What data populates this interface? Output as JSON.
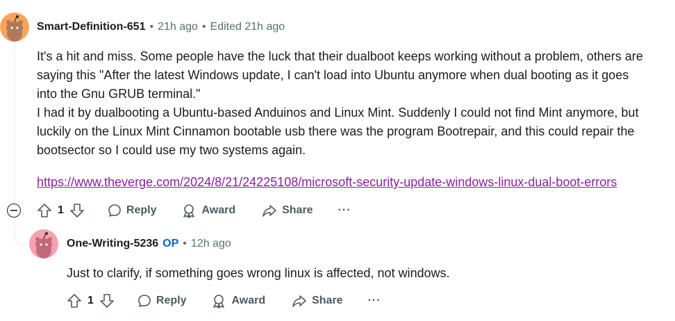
{
  "comment1": {
    "username": "Smart-Definition-651",
    "time": "21h ago",
    "edited": "Edited 21h ago",
    "lines": [
      "It's a hit and miss. Some people have the luck that their dualboot keeps working without a problem, others are",
      "saying this \"After the latest Windows update, I can't load into Ubuntu anymore when dual booting as it goes",
      "into the Gnu GRUB terminal.\"",
      "I had it by dualbooting a Ubuntu-based Anduinos and Linux Mint. Suddenly I could not find Mint anymore, but",
      "luckily on the Linux Mint Cinnamon bootable usb there was the program Bootrepair, and this could repair the",
      "bootsector so I could use my two systems again."
    ],
    "link": "https://www.theverge.com/2024/8/21/24225108/microsoft-security-update-windows-linux-dual-boot-errors",
    "votes": "1",
    "reply_label": "Reply",
    "award_label": "Award",
    "share_label": "Share",
    "more_label": "···",
    "avatar_color": "#f9a35c"
  },
  "comment2": {
    "username": "One-Writing-5236",
    "op_badge": "OP",
    "time": "12h ago",
    "text": "Just to clarify, if something goes wrong linux is affected, not windows.",
    "votes": "1",
    "reply_label": "Reply",
    "award_label": "Award",
    "share_label": "Share",
    "more_label": "···",
    "avatar_color": "#f7a1b0"
  },
  "separator": "•"
}
